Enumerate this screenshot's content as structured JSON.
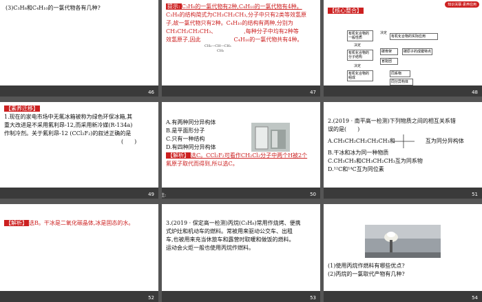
{
  "slides": [
    {
      "num": "46",
      "text": "(3)C₃H₈和C₄H₁₀的一氯代物各有几种?"
    },
    {
      "num": "47",
      "tag": "提示:",
      "l1": "C₃H₈的一氯代物有2种,C₄H₁₀的一氯代物有4种。",
      "l2": "C₃H₈的结构简式为CH₃CH₂CH₃,分子中只有2类等效氢原",
      "l3": "子,故一氯代物只有2种。C₄H₁₀的结构有两种,分别为",
      "l4": "CH₃CH₂CH₂CH₃、",
      "l5": ",每种分子中均有2种等",
      "l6": "效氢原子,因此",
      "l7": "C₄H₁₀的一氯代物共有4种。",
      "chem": "CH₃—CH—CH₃",
      "chem2": "CH₃"
    },
    {
      "num": "48",
      "header": "知识关联·素养应用",
      "title": "【核心整合】",
      "b1": "有机化合物的一般性质",
      "b2": "决定",
      "b3": "有机化合物的实际应用",
      "b4": "决定",
      "b5": "有机化合物的分子结构",
      "b6": "碳骨架",
      "b7": "官能团",
      "b8": "碳原子的成键特点",
      "b9": "决定",
      "b10": "有机化合物的组成",
      "b11": "同系物",
      "b12": "同分异构体"
    },
    {
      "num": "49",
      "tag": "【素养迁移】",
      "l1": "1.现在的家电市场中无氟冰箱被称为绿色环保冰箱,其",
      "l2": "重大改进是不采用氟利昂-12,而采用新冷媒(R-134a)",
      "l3": "作制冷剂。关于氟利昂-12 (CCl₂F₂)的叙述正确的是",
      "l4": "(　　)"
    },
    {
      "num": "50",
      "a": "A.有两种同分异构体",
      "b": "B.是平面形分子",
      "c": "C.只有一种结构",
      "d": "D.有四种同分异构体",
      "tag": "【解析】",
      "s1": "选C。CCl₂F₂可看作CH₂Cl₂分子中两个H被2个",
      "s2": "氟原子取代而得到,所以选C。",
      "corner": "注:"
    },
    {
      "num": "51",
      "q1": "2.(2019 · 南平高一检测)下列物质之间的相互关系错",
      "q2": "误的是(　　)",
      "a": "A.CH₃CH₂CH₂CH₂CH₃和",
      "a2": "互为同分异构体",
      "b": "B.干冰和冰为同一种物质",
      "c": "C.CH₃CH₃和CH₃CH₂CH₃互为同系物",
      "d": "D.¹²C和¹⁴C互为同位素"
    },
    {
      "num": "52",
      "tag": "【解析】",
      "text": "选B。干冰是二氧化碳晶体,冰是固态的水。"
    },
    {
      "num": "53",
      "l1": "3.(2019 · 保定高一检测)丙烷(C₃H₈)常用作烧烤、便携",
      "l2": "式炉灶和机动车的燃料。常被用来驱动公交车、出租",
      "l3": "车,也被用来充当休旅车和露营时取暖和做饭的燃料。",
      "l4": "运动会火炬一般也使用丙烷作燃料。"
    },
    {
      "num": "54",
      "q1": "(1)使用丙烷作燃料有哪些优点?",
      "q2": "(2)丙烷的一氯取代产物有几种?"
    }
  ]
}
